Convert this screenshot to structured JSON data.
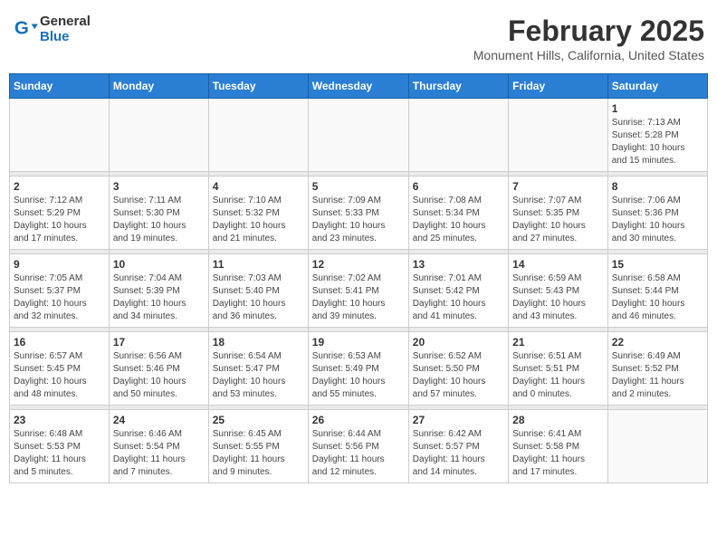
{
  "header": {
    "logo_general": "General",
    "logo_blue": "Blue",
    "title": "February 2025",
    "subtitle": "Monument Hills, California, United States"
  },
  "days_of_week": [
    "Sunday",
    "Monday",
    "Tuesday",
    "Wednesday",
    "Thursday",
    "Friday",
    "Saturday"
  ],
  "weeks": [
    [
      {
        "day": "",
        "info": ""
      },
      {
        "day": "",
        "info": ""
      },
      {
        "day": "",
        "info": ""
      },
      {
        "day": "",
        "info": ""
      },
      {
        "day": "",
        "info": ""
      },
      {
        "day": "",
        "info": ""
      },
      {
        "day": "1",
        "info": "Sunrise: 7:13 AM\nSunset: 5:28 PM\nDaylight: 10 hours\nand 15 minutes."
      }
    ],
    [
      {
        "day": "2",
        "info": "Sunrise: 7:12 AM\nSunset: 5:29 PM\nDaylight: 10 hours\nand 17 minutes."
      },
      {
        "day": "3",
        "info": "Sunrise: 7:11 AM\nSunset: 5:30 PM\nDaylight: 10 hours\nand 19 minutes."
      },
      {
        "day": "4",
        "info": "Sunrise: 7:10 AM\nSunset: 5:32 PM\nDaylight: 10 hours\nand 21 minutes."
      },
      {
        "day": "5",
        "info": "Sunrise: 7:09 AM\nSunset: 5:33 PM\nDaylight: 10 hours\nand 23 minutes."
      },
      {
        "day": "6",
        "info": "Sunrise: 7:08 AM\nSunset: 5:34 PM\nDaylight: 10 hours\nand 25 minutes."
      },
      {
        "day": "7",
        "info": "Sunrise: 7:07 AM\nSunset: 5:35 PM\nDaylight: 10 hours\nand 27 minutes."
      },
      {
        "day": "8",
        "info": "Sunrise: 7:06 AM\nSunset: 5:36 PM\nDaylight: 10 hours\nand 30 minutes."
      }
    ],
    [
      {
        "day": "9",
        "info": "Sunrise: 7:05 AM\nSunset: 5:37 PM\nDaylight: 10 hours\nand 32 minutes."
      },
      {
        "day": "10",
        "info": "Sunrise: 7:04 AM\nSunset: 5:39 PM\nDaylight: 10 hours\nand 34 minutes."
      },
      {
        "day": "11",
        "info": "Sunrise: 7:03 AM\nSunset: 5:40 PM\nDaylight: 10 hours\nand 36 minutes."
      },
      {
        "day": "12",
        "info": "Sunrise: 7:02 AM\nSunset: 5:41 PM\nDaylight: 10 hours\nand 39 minutes."
      },
      {
        "day": "13",
        "info": "Sunrise: 7:01 AM\nSunset: 5:42 PM\nDaylight: 10 hours\nand 41 minutes."
      },
      {
        "day": "14",
        "info": "Sunrise: 6:59 AM\nSunset: 5:43 PM\nDaylight: 10 hours\nand 43 minutes."
      },
      {
        "day": "15",
        "info": "Sunrise: 6:58 AM\nSunset: 5:44 PM\nDaylight: 10 hours\nand 46 minutes."
      }
    ],
    [
      {
        "day": "16",
        "info": "Sunrise: 6:57 AM\nSunset: 5:45 PM\nDaylight: 10 hours\nand 48 minutes."
      },
      {
        "day": "17",
        "info": "Sunrise: 6:56 AM\nSunset: 5:46 PM\nDaylight: 10 hours\nand 50 minutes."
      },
      {
        "day": "18",
        "info": "Sunrise: 6:54 AM\nSunset: 5:47 PM\nDaylight: 10 hours\nand 53 minutes."
      },
      {
        "day": "19",
        "info": "Sunrise: 6:53 AM\nSunset: 5:49 PM\nDaylight: 10 hours\nand 55 minutes."
      },
      {
        "day": "20",
        "info": "Sunrise: 6:52 AM\nSunset: 5:50 PM\nDaylight: 10 hours\nand 57 minutes."
      },
      {
        "day": "21",
        "info": "Sunrise: 6:51 AM\nSunset: 5:51 PM\nDaylight: 11 hours\nand 0 minutes."
      },
      {
        "day": "22",
        "info": "Sunrise: 6:49 AM\nSunset: 5:52 PM\nDaylight: 11 hours\nand 2 minutes."
      }
    ],
    [
      {
        "day": "23",
        "info": "Sunrise: 6:48 AM\nSunset: 5:53 PM\nDaylight: 11 hours\nand 5 minutes."
      },
      {
        "day": "24",
        "info": "Sunrise: 6:46 AM\nSunset: 5:54 PM\nDaylight: 11 hours\nand 7 minutes."
      },
      {
        "day": "25",
        "info": "Sunrise: 6:45 AM\nSunset: 5:55 PM\nDaylight: 11 hours\nand 9 minutes."
      },
      {
        "day": "26",
        "info": "Sunrise: 6:44 AM\nSunset: 5:56 PM\nDaylight: 11 hours\nand 12 minutes."
      },
      {
        "day": "27",
        "info": "Sunrise: 6:42 AM\nSunset: 5:57 PM\nDaylight: 11 hours\nand 14 minutes."
      },
      {
        "day": "28",
        "info": "Sunrise: 6:41 AM\nSunset: 5:58 PM\nDaylight: 11 hours\nand 17 minutes."
      },
      {
        "day": "",
        "info": ""
      }
    ]
  ]
}
